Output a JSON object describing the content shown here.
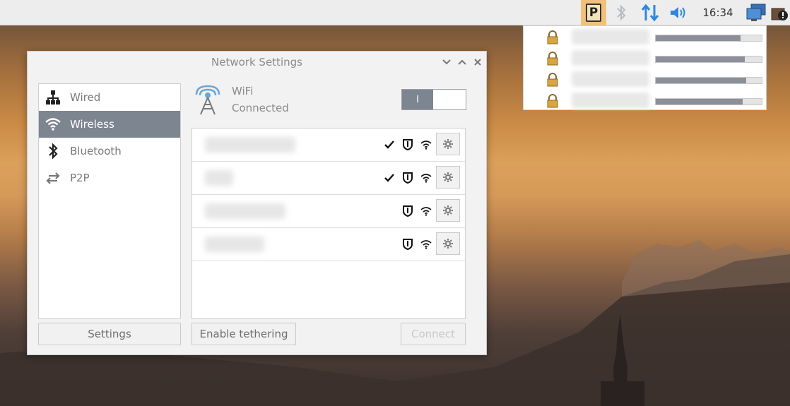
{
  "panel": {
    "clock": "16:34",
    "priority_app_letter": "P",
    "icons": [
      "priority-p-icon",
      "bluetooth-icon",
      "network-updown-icon",
      "volume-icon",
      "monitor-network-icon",
      "update-alert-icon"
    ]
  },
  "wifi_menu": {
    "items": [
      {
        "locked": true,
        "signal": 0.8
      },
      {
        "locked": true,
        "signal": 0.84
      },
      {
        "locked": true,
        "signal": 0.85
      },
      {
        "locked": true,
        "signal": 0.82
      }
    ]
  },
  "dialog": {
    "title": "Network Settings",
    "sidebar": {
      "items": [
        {
          "label": "Wired",
          "icon": "wired-network-icon",
          "active": false
        },
        {
          "label": "Wireless",
          "icon": "wifi-icon",
          "active": true
        },
        {
          "label": "Bluetooth",
          "icon": "bluetooth-icon",
          "active": false
        },
        {
          "label": "P2P",
          "icon": "p2p-arrows-icon",
          "active": false
        }
      ]
    },
    "status": {
      "name": "WiFi",
      "state": "Connected",
      "toggle_on_label": "I",
      "toggle_on": true
    },
    "networks": [
      {
        "saved": true,
        "secured": true
      },
      {
        "saved": true,
        "secured": true
      },
      {
        "saved": false,
        "secured": true
      },
      {
        "saved": false,
        "secured": true
      }
    ],
    "buttons": {
      "settings": "Settings",
      "tethering": "Enable tethering",
      "connect": "Connect"
    },
    "accent": "#7c8590"
  }
}
